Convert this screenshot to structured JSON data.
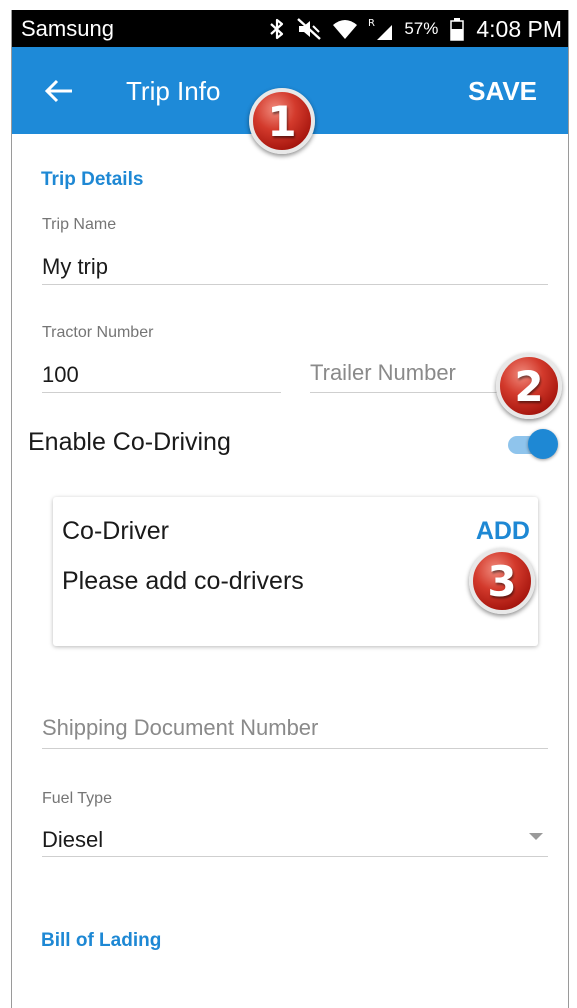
{
  "status_bar": {
    "carrier": "Samsung",
    "battery_percent": "57%",
    "time": "4:08 PM",
    "icons": [
      "bluetooth-icon",
      "mute-icon",
      "wifi-icon",
      "signal-roaming-icon",
      "battery-icon"
    ],
    "roaming_mark": "R"
  },
  "app_bar": {
    "title": "Trip Info",
    "save_label": "SAVE",
    "back_icon": "back-arrow-icon",
    "color": "#1e8ad8"
  },
  "badges": {
    "one": "1",
    "two": "2",
    "three": "3"
  },
  "trip_details": {
    "section_title": "Trip Details",
    "trip_name": {
      "label": "Trip Name",
      "value": "My trip"
    },
    "tractor_number": {
      "label": "Tractor Number",
      "value": "100"
    },
    "trailer_number": {
      "placeholder": "Trailer Number"
    }
  },
  "co_driving": {
    "label": "Enable Co-Driving",
    "enabled": true,
    "card": {
      "title": "Co-Driver",
      "add_label": "ADD",
      "message": "Please add co-drivers"
    }
  },
  "shipping": {
    "placeholder": "Shipping Document Number"
  },
  "fuel": {
    "label": "Fuel Type",
    "value": "Diesel"
  },
  "bill_of_lading": {
    "section_title": "Bill of Lading"
  },
  "colors": {
    "accent": "#1e88d4",
    "badge": "#c8281c"
  }
}
